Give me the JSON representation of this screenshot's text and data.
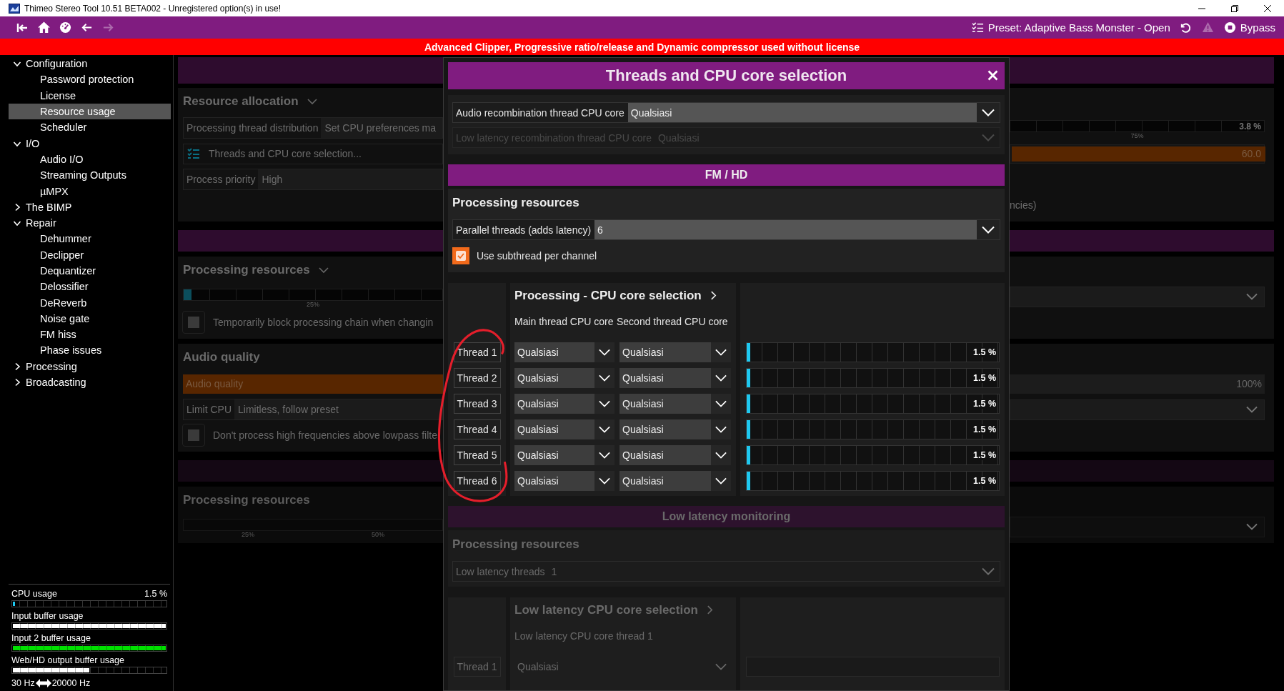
{
  "window": {
    "title": "Thimeo Stereo Tool 10.51 BETA002 - Unregistered option(s) in use!"
  },
  "toolbar": {
    "preset": "Preset: Adaptive Bass Monster - Open",
    "bypass": "Bypass",
    "forward_disabled": true,
    "warning_disabled": true
  },
  "banner": "Advanced Clipper, Progressive ratio/release and Dynamic compressor used without license",
  "sidebar": {
    "tree": [
      {
        "label": "Configuration",
        "selected": false,
        "expanded": true,
        "children": [
          {
            "label": "Password protection",
            "selected": false
          },
          {
            "label": "License",
            "selected": false
          },
          {
            "label": "Resource usage",
            "selected": true
          },
          {
            "label": "Scheduler",
            "selected": false
          }
        ]
      },
      {
        "label": "I/O",
        "selected": false,
        "expanded": true,
        "children": [
          {
            "label": "Audio I/O",
            "selected": false
          },
          {
            "label": "Streaming Outputs",
            "selected": false
          },
          {
            "label": "µMPX",
            "selected": false
          }
        ]
      },
      {
        "label": "The BIMP",
        "selected": false,
        "expanded": false
      },
      {
        "label": "Repair",
        "selected": false,
        "expanded": true,
        "children": [
          {
            "label": "Dehummer",
            "selected": false
          },
          {
            "label": "Declipper",
            "selected": false
          },
          {
            "label": "Dequantizer",
            "selected": false
          },
          {
            "label": "Delossifier",
            "selected": false
          },
          {
            "label": "DeReverb",
            "selected": false
          },
          {
            "label": "Noise gate",
            "selected": false
          },
          {
            "label": "FM hiss",
            "selected": false
          },
          {
            "label": "Phase issues",
            "selected": false
          }
        ]
      },
      {
        "label": "Processing",
        "selected": false,
        "expanded": false
      },
      {
        "label": "Broadcasting",
        "selected": false,
        "expanded": false
      }
    ],
    "meters": [
      {
        "label": "CPU usage",
        "reading": "1.5 %",
        "level": 0.015,
        "color": "#1ec8f0"
      },
      {
        "label": "Input buffer usage",
        "level": 1,
        "color": "#ffffff"
      },
      {
        "label": "Input 2 buffer usage",
        "level": 1,
        "color": "#00e000"
      },
      {
        "label": "Web/HD output buffer usage",
        "level": 0.5,
        "color": "#ffffff"
      }
    ],
    "range": {
      "low": "30 Hz",
      "high": "20000 Hz"
    }
  },
  "background": {
    "groups": [
      {
        "faded": false,
        "panels": [
          {
            "title": "Resource allocation",
            "caret": true,
            "rows": [
              {
                "left": {
                  "kind": "pair",
                  "label": "Processing thread distribution",
                  "value": "Set CPU preferences ma"
                },
                "right": {
                  "kind": "meter",
                  "reading": "3.8 %",
                  "ticks": [
                    "75%"
                  ]
                }
              },
              {
                "left": {
                  "kind": "link",
                  "label": "Threads and CPU core selection..."
                },
                "right": {
                  "kind": "slider",
                  "reading": "60.0",
                  "level": 1
                }
              },
              {
                "left": {
                  "kind": "pair",
                  "label": "Process priority",
                  "value": "High"
                }
              },
              {
                "right": {
                  "kind": "text",
                  "label": "ncies)"
                }
              }
            ]
          }
        ]
      },
      {
        "faded": false,
        "panels": [
          {
            "title": "Processing resources",
            "caret": true,
            "rows": [
              {
                "left": {
                  "kind": "meter",
                  "level": 0.03,
                  "ticks": [
                    "25%"
                  ]
                },
                "right": {
                  "kind": "dropdown"
                }
              },
              {
                "left": {
                  "kind": "checkbox",
                  "label": "Temporarily block processing chain when changin",
                  "checked": false
                }
              }
            ]
          },
          {
            "title": "Audio quality",
            "rows": [
              {
                "wide": {
                  "label": "Audio quality",
                  "reading": "100%",
                  "level": 0.5
                }
              },
              {
                "left": {
                  "kind": "pair",
                  "label": "Limit CPU",
                  "value": "Limitless, follow preset"
                },
                "right": {
                  "kind": "dropdown"
                }
              },
              {
                "left": {
                  "kind": "checkbox",
                  "label": "Don't process high frequencies above lowpass filte",
                  "checked": false
                }
              }
            ]
          }
        ]
      },
      {
        "faded": true,
        "panels": [
          {
            "title": "Processing resources",
            "rows": [
              {
                "left": {
                  "kind": "meter",
                  "ticks": [
                    "25%",
                    "50%"
                  ]
                },
                "right": {
                  "kind": "dropdown"
                }
              }
            ]
          }
        ]
      }
    ]
  },
  "dialog": {
    "title": "Threads and CPU core selection",
    "top_rows": [
      {
        "label": "Audio recombination thread CPU core",
        "value": "Qualsiasi",
        "disabled": false
      },
      {
        "label": "Low latency recombination thread CPU core",
        "value": "Qualsiasi",
        "disabled": true
      }
    ],
    "sections": [
      {
        "header": "FM / HD",
        "disabled": false,
        "resources": {
          "title": "Processing resources",
          "dropdown": {
            "label": "Parallel threads (adds latency)",
            "value": "6"
          },
          "checkbox": {
            "label": "Use subthread per channel",
            "checked": true
          }
        },
        "cores": {
          "title": "Processing - CPU core selection",
          "columns": [
            "Main thread CPU core",
            "Second thread CPU core"
          ],
          "threads": [
            {
              "label": "Thread 1",
              "main": "Qualsiasi",
              "second": "Qualsiasi",
              "level": 0.015,
              "reading": "1.5 %"
            },
            {
              "label": "Thread 2",
              "main": "Qualsiasi",
              "second": "Qualsiasi",
              "level": 0.015,
              "reading": "1.5 %"
            },
            {
              "label": "Thread 3",
              "main": "Qualsiasi",
              "second": "Qualsiasi",
              "level": 0.015,
              "reading": "1.5 %"
            },
            {
              "label": "Thread 4",
              "main": "Qualsiasi",
              "second": "Qualsiasi",
              "level": 0.015,
              "reading": "1.5 %"
            },
            {
              "label": "Thread 5",
              "main": "Qualsiasi",
              "second": "Qualsiasi",
              "level": 0.015,
              "reading": "1.5 %"
            },
            {
              "label": "Thread 6",
              "main": "Qualsiasi",
              "second": "Qualsiasi",
              "level": 0.015,
              "reading": "1.5 %"
            }
          ]
        }
      },
      {
        "header": "Low latency monitoring",
        "disabled": true,
        "resources": {
          "title": "Processing resources",
          "dropdown": {
            "label": "Low latency threads",
            "value": "1"
          }
        },
        "cores": {
          "title": "Low latency CPU core selection",
          "columns": [
            "Low latency CPU core thread 1"
          ],
          "threads": [
            {
              "label": "Thread 1",
              "main": "Qualsiasi"
            }
          ]
        }
      }
    ]
  }
}
